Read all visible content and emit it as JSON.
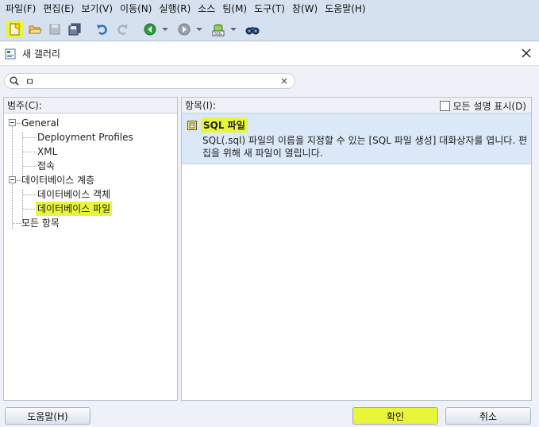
{
  "menu": {
    "items": [
      "파일(F)",
      "편집(E)",
      "보기(V)",
      "이동(N)",
      "실행(R)",
      "소스",
      "팀(M)",
      "도구(T)",
      "창(W)",
      "도움말(H)"
    ]
  },
  "toolbar": {
    "icons": [
      "new-gallery-icon",
      "open-icon",
      "save-icon",
      "save-all-icon",
      "undo-icon",
      "redo-icon",
      "back-icon",
      "forward-icon",
      "sql-icon",
      "binoculars-icon"
    ]
  },
  "dialog": {
    "title": "새 갤러리"
  },
  "search": {
    "value": "ㅁ"
  },
  "categories": {
    "header": "범주(C):",
    "tree": [
      {
        "label": "General",
        "level": 0,
        "expanded": true
      },
      {
        "label": "Deployment Profiles",
        "level": 1
      },
      {
        "label": "XML",
        "level": 1
      },
      {
        "label": "접속",
        "level": 1
      },
      {
        "label": "데이터베이스 계층",
        "level": 0,
        "expanded": true
      },
      {
        "label": "데이터베이스 객체",
        "level": 1
      },
      {
        "label": "데이터베이스 파일",
        "level": 1,
        "selected": true
      },
      {
        "label": "모든 항목",
        "level": 0
      }
    ]
  },
  "items": {
    "header": "항목(I):",
    "show_all_label": "모든 설명 표시(D)",
    "show_all_checked": false,
    "entries": [
      {
        "title": "SQL 파일",
        "description": "SQL(.sql) 파일의 이름을 지정할 수 있는 [SQL 파일 생성] 대화상자를 엽니다. 편집을 위해 새 파일이 열립니다."
      }
    ]
  },
  "buttons": {
    "help": "도움말(H)",
    "ok": "확인",
    "cancel": "취소"
  },
  "colors": {
    "highlight": "#e8f53a",
    "chrome": "#d6e1ef",
    "selected_item_bg": "#dbe8f8"
  }
}
